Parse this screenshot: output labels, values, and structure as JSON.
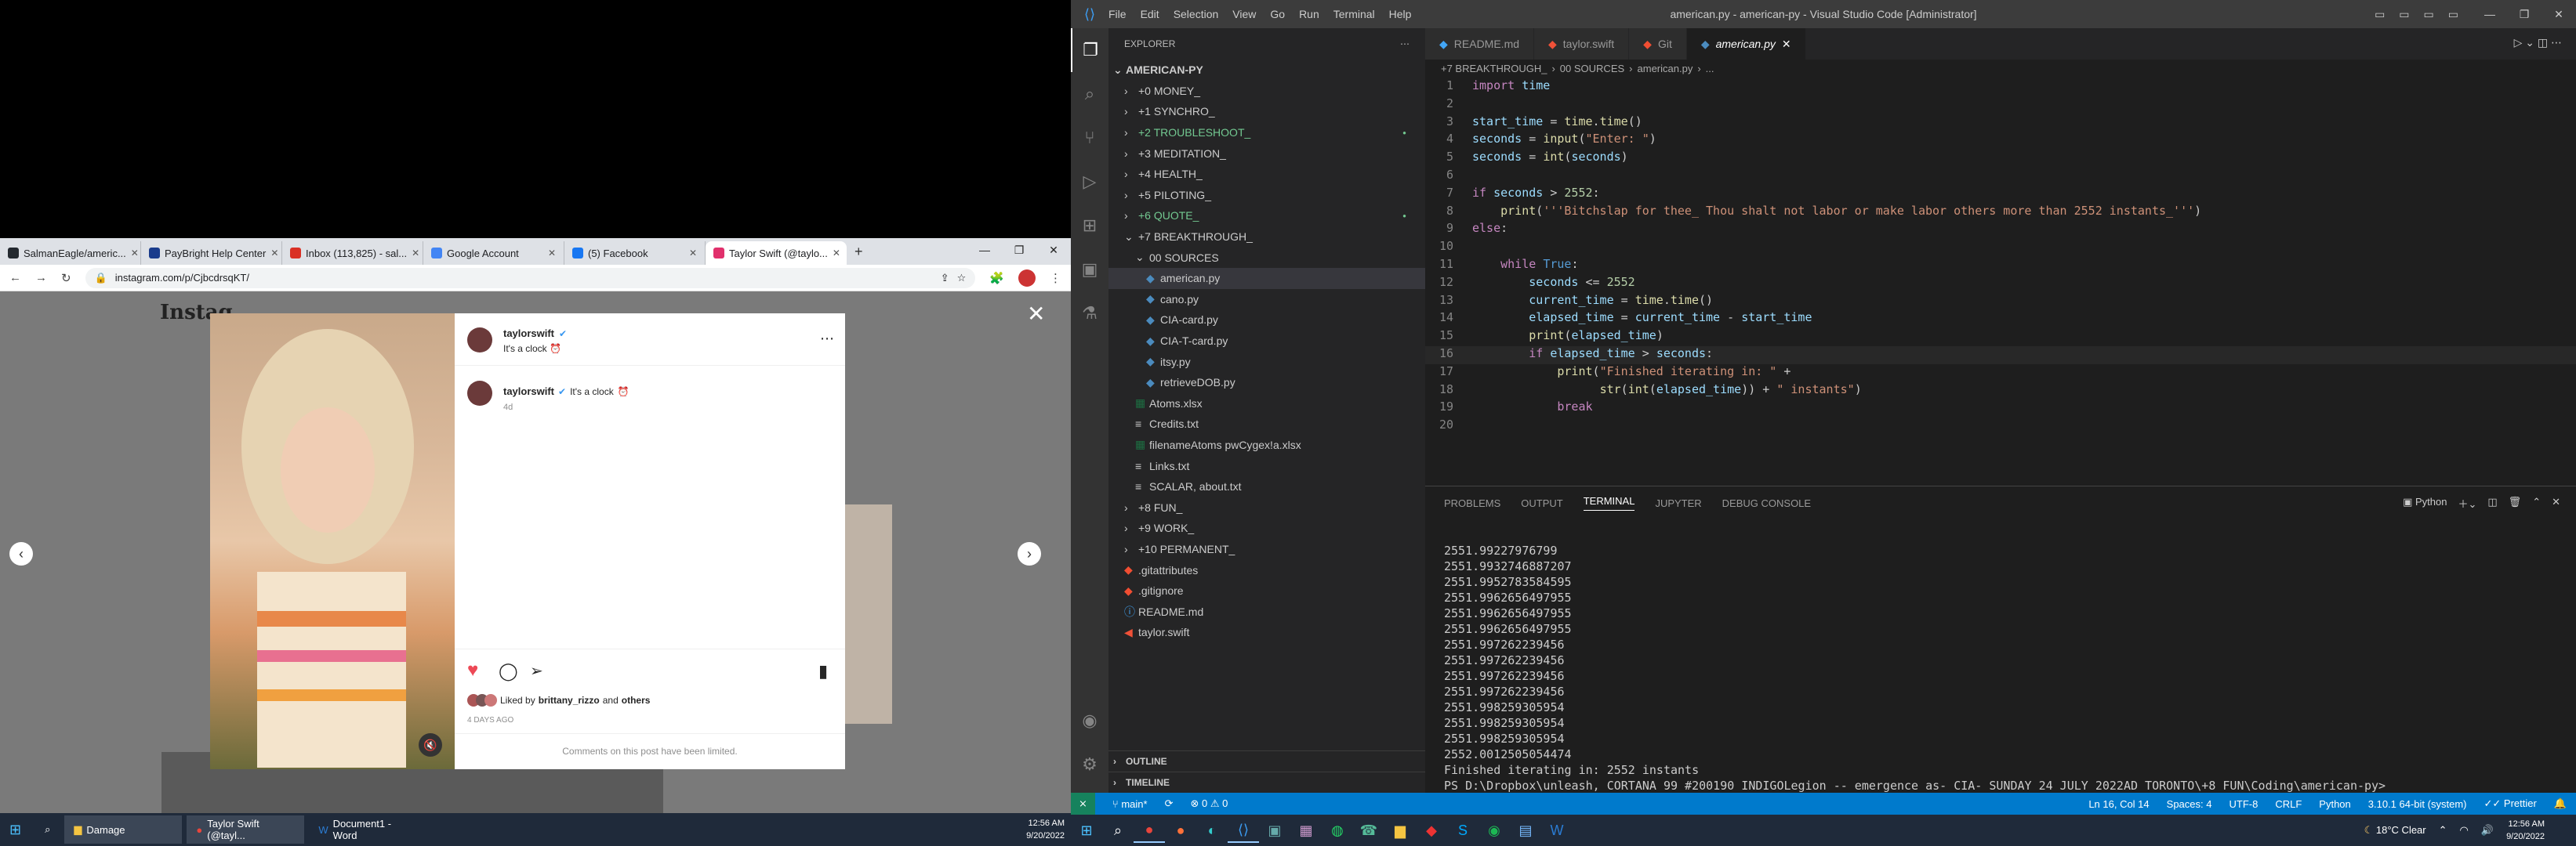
{
  "browser": {
    "tabs": [
      {
        "label": "SalmanEagle/americ...",
        "icon": "github-icon",
        "color": "#24292f"
      },
      {
        "label": "PayBright Help Center",
        "icon": "paybright-icon",
        "color": "#1a3c8c"
      },
      {
        "label": "Inbox (113,825) - sal...",
        "icon": "gmail-icon",
        "color": "#d93025"
      },
      {
        "label": "Google Account",
        "icon": "google-icon",
        "color": "#4285f4"
      },
      {
        "label": "(5) Facebook",
        "icon": "facebook-icon",
        "color": "#1877f2"
      },
      {
        "label": "Taylor Swift (@taylo...",
        "icon": "instagram-icon",
        "color": "#e1306c"
      }
    ],
    "url": "instagram.com/p/CjbcdrsqKT/"
  },
  "instagram": {
    "username": "taylorswift",
    "caption": "It's a clock",
    "emoji": "⏰",
    "time_ago": "4d",
    "liked_by_prefix": "Liked by",
    "liked_by_user": "brittany_rizzo",
    "liked_by_and": "and",
    "liked_by_others": "others",
    "date": "4 DAYS AGO",
    "comments_limited": "Comments on this post have been limited.",
    "logo_fragment": "Instag"
  },
  "taskbar_left": {
    "items": [
      "Damage",
      "Taylor Swift (@tayl...",
      "Document1 - Word"
    ],
    "time": "12:56 AM",
    "date": "9/20/2022"
  },
  "vscode": {
    "title": "american.py - american-py - Visual Studio Code [Administrator]",
    "menu": [
      "File",
      "Edit",
      "Selection",
      "View",
      "Go",
      "Run",
      "Terminal",
      "Help"
    ],
    "explorer_header": "EXPLORER",
    "root": "AMERICAN-PY",
    "tree": [
      {
        "label": "+0 MONEY_",
        "indent": 1,
        "type": "folder",
        "color": "#ccc"
      },
      {
        "label": "+1 SYNCHRO_",
        "indent": 1,
        "type": "folder",
        "color": "#ccc"
      },
      {
        "label": "+2 TROUBLESHOOT_",
        "indent": 1,
        "type": "folder",
        "color": "#73c991",
        "dot": true
      },
      {
        "label": "+3 MEDITATION_",
        "indent": 1,
        "type": "folder",
        "color": "#ccc"
      },
      {
        "label": "+4 HEALTH_",
        "indent": 1,
        "type": "folder",
        "color": "#ccc"
      },
      {
        "label": "+5 PILOTING_",
        "indent": 1,
        "type": "folder",
        "color": "#ccc"
      },
      {
        "label": "+6 QUOTE_",
        "indent": 1,
        "type": "folder",
        "color": "#73c991",
        "dot": true
      },
      {
        "label": "+7 BREAKTHROUGH_",
        "indent": 1,
        "type": "open",
        "color": "#ccc"
      },
      {
        "label": "00 SOURCES",
        "indent": 2,
        "type": "open",
        "color": "#ccc"
      },
      {
        "label": "american.py",
        "indent": 3,
        "type": "py",
        "color": "#ccc",
        "selected": true
      },
      {
        "label": "cano.py",
        "indent": 3,
        "type": "py",
        "color": "#ccc"
      },
      {
        "label": "CIA-card.py",
        "indent": 3,
        "type": "py",
        "color": "#ccc"
      },
      {
        "label": "CIA-T-card.py",
        "indent": 3,
        "type": "py",
        "color": "#ccc"
      },
      {
        "label": "itsy.py",
        "indent": 3,
        "type": "py",
        "color": "#ccc"
      },
      {
        "label": "retrieveDOB.py",
        "indent": 3,
        "type": "py",
        "color": "#ccc"
      },
      {
        "label": "Atoms.xlsx",
        "indent": 2,
        "type": "xlsx",
        "color": "#ccc"
      },
      {
        "label": "Credits.txt",
        "indent": 2,
        "type": "txt",
        "color": "#ccc"
      },
      {
        "label": "filenameAtoms pwCygex!a.xlsx",
        "indent": 2,
        "type": "xlsx",
        "color": "#ccc"
      },
      {
        "label": "Links.txt",
        "indent": 2,
        "type": "txt",
        "color": "#ccc"
      },
      {
        "label": "SCALAR, about.txt",
        "indent": 2,
        "type": "txt",
        "color": "#ccc"
      },
      {
        "label": "+8 FUN_",
        "indent": 1,
        "type": "folder",
        "color": "#ccc"
      },
      {
        "label": "+9 WORK_",
        "indent": 1,
        "type": "folder",
        "color": "#ccc"
      },
      {
        "label": "+10 PERMANENT_",
        "indent": 1,
        "type": "folder",
        "color": "#ccc"
      },
      {
        "label": ".gitattributes",
        "indent": 1,
        "type": "git",
        "color": "#ccc"
      },
      {
        "label": ".gitignore",
        "indent": 1,
        "type": "git",
        "color": "#ccc"
      },
      {
        "label": "README.md",
        "indent": 1,
        "type": "md",
        "color": "#ccc"
      },
      {
        "label": "taylor.swift",
        "indent": 1,
        "type": "swift",
        "color": "#ccc"
      }
    ],
    "outline": "OUTLINE",
    "timeline": "TIMELINE",
    "editor_tabs": [
      {
        "label": "README.md",
        "icon": "info-icon"
      },
      {
        "label": "taylor.swift",
        "icon": "swift-icon"
      },
      {
        "label": "Git",
        "icon": "git-icon"
      },
      {
        "label": "american.py",
        "icon": "python-icon",
        "active": true
      }
    ],
    "breadcrumbs": [
      "+7 BREAKTHROUGH_",
      "00 SOURCES",
      "american.py",
      "..."
    ],
    "code": [
      "import time",
      "",
      "start_time = time.time()",
      "seconds = input(\"Enter: \")",
      "seconds = int(seconds)",
      "",
      "if seconds > 2552:",
      "    print('''Bitchslap for thee_ Thou shalt not labor or make labor others more than 2552 instants_''')",
      "else:",
      "",
      "    while True:",
      "        seconds <= 2552",
      "        current_time = time.time()",
      "        elapsed_time = current_time - start_time",
      "        print(elapsed_time)",
      "        if elapsed_time > seconds:",
      "            print(\"Finished iterating in: \" +",
      "                  str(int(elapsed_time)) + \" instants\")",
      "            break",
      ""
    ],
    "panel_tabs": [
      "PROBLEMS",
      "OUTPUT",
      "TERMINAL",
      "JUPYTER",
      "DEBUG CONSOLE"
    ],
    "panel_active": "TERMINAL",
    "panel_shell": "Python",
    "terminal": [
      "2551.99227976799",
      "2551.9932746887207",
      "2551.9952783584595",
      "2551.9962656497955",
      "2551.9962656497955",
      "2551.9962656497955",
      "2551.997262239456",
      "2551.997262239456",
      "2551.997262239456",
      "2551.997262239456",
      "2551.998259305954",
      "2551.998259305954",
      "2551.998259305954",
      "2552.0012505054474",
      "Finished iterating in: 2552 instants",
      "PS D:\\Dropbox\\unleash, CORTANA 99 #200190 INDIGOLegion -- emergence as- CIA- SUNDAY 24 JULY 2022AD TORONTO\\+8 FUN\\Coding\\american-py> "
    ],
    "status": {
      "branch": "main*",
      "errors": "0",
      "warnings": "0",
      "position": "Ln 16, Col 14",
      "spaces": "Spaces: 4",
      "encoding": "UTF-8",
      "eol": "CRLF",
      "language": "Python",
      "interpreter": "3.10.1 64-bit (system)",
      "prettier": "Prettier"
    },
    "taskbar": {
      "weather": "18°C  Clear",
      "time": "12:56 AM",
      "date": "9/20/2022"
    }
  }
}
